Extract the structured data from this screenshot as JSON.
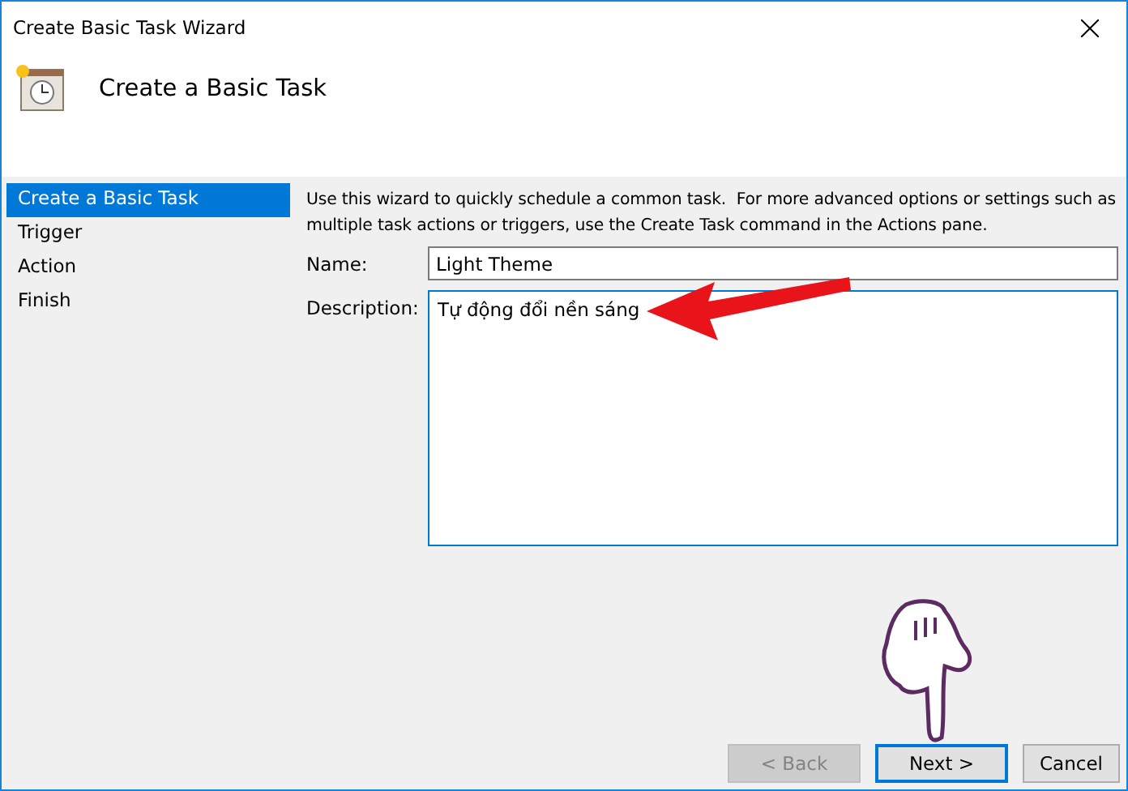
{
  "window": {
    "title": "Create Basic Task Wizard"
  },
  "header": {
    "title": "Create a Basic Task"
  },
  "steps": [
    {
      "label": "Create a Basic Task",
      "selected": true
    },
    {
      "label": "Trigger",
      "selected": false
    },
    {
      "label": "Action",
      "selected": false
    },
    {
      "label": "Finish",
      "selected": false
    }
  ],
  "intro": "Use this wizard to quickly schedule a common task.  For more advanced options or settings such as multiple task actions or triggers, use the Create Task command in the Actions pane.",
  "fields": [
    {
      "label": "Name:",
      "value": "Light Theme",
      "kind": "line"
    },
    {
      "label": "Description:",
      "value": "Tự động đổi nền sáng",
      "kind": "area"
    }
  ],
  "buttons": [
    {
      "label": "< Back",
      "disabled": true,
      "default": false
    },
    {
      "label": "Next >",
      "disabled": false,
      "default": true
    },
    {
      "label": "Cancel",
      "disabled": false,
      "default": false
    }
  ]
}
